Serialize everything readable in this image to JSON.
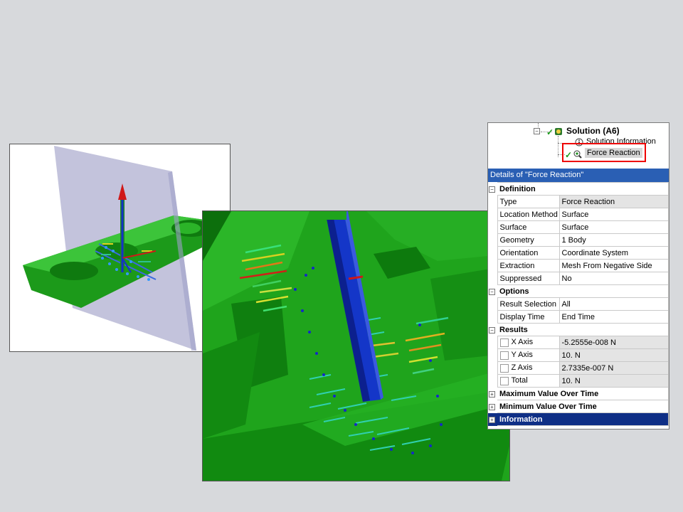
{
  "tree": {
    "solution_label": "Solution (A6)",
    "solution_info_label": "Solution Information",
    "force_reaction_label": "Force Reaction"
  },
  "details": {
    "title": "Details of \"Force Reaction\"",
    "sections": {
      "definition": "Definition",
      "options": "Options",
      "results": "Results",
      "max": "Maximum Value Over Time",
      "min": "Minimum Value Over Time",
      "information": "Information"
    },
    "definition": [
      {
        "label": "Type",
        "value": "Force Reaction"
      },
      {
        "label": "Location Method",
        "value": "Surface"
      },
      {
        "label": "Surface",
        "value": "Surface"
      },
      {
        "label": "Geometry",
        "value": "1 Body"
      },
      {
        "label": "Orientation",
        "value": "Coordinate System"
      },
      {
        "label": "Extraction",
        "value": "Mesh From Negative Side"
      },
      {
        "label": "Suppressed",
        "value": "No"
      }
    ],
    "options": [
      {
        "label": "Result Selection",
        "value": "All"
      },
      {
        "label": "Display Time",
        "value": "End Time"
      }
    ],
    "results": [
      {
        "label": "X Axis",
        "value": "-5.2555e-008 N"
      },
      {
        "label": "Y Axis",
        "value": "10. N"
      },
      {
        "label": "Z Axis",
        "value": "2.7335e-007 N"
      },
      {
        "label": "Total",
        "value": "10. N"
      }
    ]
  },
  "colors": {
    "part_green": "#22a81e",
    "shaft_blue": "#1432c8",
    "highlight_red": "#e00000",
    "selected_section": "#0f2f86"
  }
}
